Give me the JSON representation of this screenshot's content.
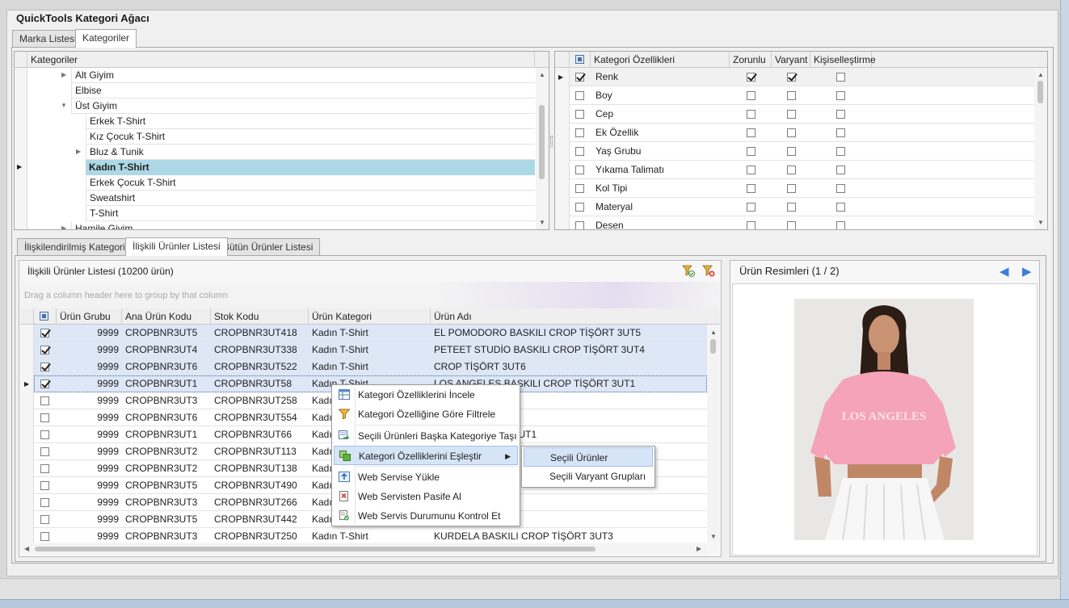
{
  "window": {
    "title": "QuickTools Kategori Ağacı"
  },
  "main_tabs": [
    {
      "label": "Marka Listesi"
    },
    {
      "label": "Kategoriler"
    }
  ],
  "category_tree": {
    "header": "Kategoriler",
    "nodes": [
      {
        "label": "Alt Giyim"
      },
      {
        "label": "Elbise"
      },
      {
        "label": "Üst Giyim"
      },
      {
        "label": "Erkek T-Shirt"
      },
      {
        "label": "Kız Çocuk T-Shirt"
      },
      {
        "label": "Bluz & Tunik"
      },
      {
        "label": "Kadın T-Shirt"
      },
      {
        "label": "Erkek Çocuk T-Shirt"
      },
      {
        "label": "Sweatshirt"
      },
      {
        "label": "T-Shirt"
      },
      {
        "label": "Hamile Giyim"
      }
    ]
  },
  "attributes": {
    "headers": {
      "name": "Kategori Özellikleri",
      "required": "Zorunlu",
      "variant": "Varyant",
      "custom": "Kişiselleştirme"
    },
    "rows": [
      {
        "name": "Renk",
        "selected": true,
        "required": true,
        "variant": true,
        "custom": false
      },
      {
        "name": "Boy",
        "selected": false,
        "required": false,
        "variant": false,
        "custom": false
      },
      {
        "name": "Cep",
        "selected": false,
        "required": false,
        "variant": false,
        "custom": false
      },
      {
        "name": "Ek Özellik",
        "selected": false,
        "required": false,
        "variant": false,
        "custom": false
      },
      {
        "name": "Yaş Grubu",
        "selected": false,
        "required": false,
        "variant": false,
        "custom": false
      },
      {
        "name": "Yıkama Talimatı",
        "selected": false,
        "required": false,
        "variant": false,
        "custom": false
      },
      {
        "name": "Kol Tipi",
        "selected": false,
        "required": false,
        "variant": false,
        "custom": false
      },
      {
        "name": "Materyal",
        "selected": false,
        "required": false,
        "variant": false,
        "custom": false
      },
      {
        "name": "Desen",
        "selected": false,
        "required": false,
        "variant": false,
        "custom": false
      }
    ]
  },
  "sub_tabs": [
    {
      "label": "İlişkilendirilmiş Kategoriler"
    },
    {
      "label": "İlişkili Ürünler Listesi"
    },
    {
      "label": "Bütün Ürünler Listesi"
    }
  ],
  "products": {
    "title": "İlişkili Ürünler Listesi (10200 ürün)",
    "group_hint": "Drag a column header here to group by that column",
    "columns": {
      "group": "Ürün Grubu",
      "main_code": "Ana Ürün Kodu",
      "stock": "Stok Kodu",
      "category": "Ürün Kategori",
      "name": "Ürün Adı"
    },
    "rows": [
      {
        "checked": true,
        "group": "9999",
        "main_code": "CROPBNR3UT5",
        "stock": "CROPBNR3UT418",
        "category": "Kadın T-Shirt",
        "name": "EL POMODORO BASKILI CROP TİŞÖRT 3UT5"
      },
      {
        "checked": true,
        "group": "9999",
        "main_code": "CROPBNR3UT4",
        "stock": "CROPBNR3UT338",
        "category": "Kadın T-Shirt",
        "name": "PETEET STUDİO BASKILI CROP TİŞÖRT 3UT4"
      },
      {
        "checked": true,
        "group": "9999",
        "main_code": "CROPBNR3UT6",
        "stock": "CROPBNR3UT522",
        "category": "Kadın T-Shirt",
        "name": "CROP TİŞÖRT 3UT6"
      },
      {
        "checked": true,
        "group": "9999",
        "main_code": "CROPBNR3UT1",
        "stock": "CROPBNR3UT58",
        "category": "Kadın T-Shirt",
        "name": "LOS ANGELES BASKILI CROP TİŞÖRT 3UT1"
      },
      {
        "checked": false,
        "group": "9999",
        "main_code": "CROPBNR3UT3",
        "stock": "CROPBNR3UT258",
        "category": "Kadın",
        "name": "ROP TİŞÖRT 3UT3"
      },
      {
        "checked": false,
        "group": "9999",
        "main_code": "CROPBNR3UT6",
        "stock": "CROPBNR3UT554",
        "category": "Kadın",
        "name": ""
      },
      {
        "checked": false,
        "group": "9999",
        "main_code": "CROPBNR3UT1",
        "stock": "CROPBNR3UT66",
        "category": "Kadın",
        "name": "LI CROP TİŞÖRT 3UT1"
      },
      {
        "checked": false,
        "group": "9999",
        "main_code": "CROPBNR3UT2",
        "stock": "CROPBNR3UT113",
        "category": "Kadın",
        "name": ""
      },
      {
        "checked": false,
        "group": "9999",
        "main_code": "CROPBNR3UT2",
        "stock": "CROPBNR3UT138",
        "category": "Kadın",
        "name": ""
      },
      {
        "checked": false,
        "group": "9999",
        "main_code": "CROPBNR3UT5",
        "stock": "CROPBNR3UT490",
        "category": "Kadın",
        "name": ""
      },
      {
        "checked": false,
        "group": "9999",
        "main_code": "CROPBNR3UT3",
        "stock": "CROPBNR3UT266",
        "category": "Kadın",
        "name": "ROP TİŞÖRT 3UT3"
      },
      {
        "checked": false,
        "group": "9999",
        "main_code": "CROPBNR3UT5",
        "stock": "CROPBNR3UT442",
        "category": "Kadın",
        "name": "ROP TİŞÖRT 3UT5"
      },
      {
        "checked": false,
        "group": "9999",
        "main_code": "CROPBNR3UT3",
        "stock": "CROPBNR3UT250",
        "category": "Kadın T-Shirt",
        "name": "KURDELA BASKILI CROP TİŞÖRT 3UT3"
      }
    ]
  },
  "context_menu": [
    {
      "label": "Kategori Özelliklerini İncele",
      "icon": "table-view-icon"
    },
    {
      "label": "Kategori Özelliğine Göre Filtrele",
      "icon": "funnel-icon"
    },
    {
      "label": "Seçili Ürünleri Başka Kategoriye Taşı",
      "icon": "move-icon"
    },
    {
      "label": "Kategori Özelliklerini Eşleştir",
      "icon": "match-icon"
    },
    {
      "label": "Web Servise Yükle",
      "icon": "upload-icon"
    },
    {
      "label": "Web Servisten Pasife Al",
      "icon": "deactivate-icon"
    },
    {
      "label": "Web Servis Durumunu Kontrol Et",
      "icon": "check-status-icon"
    }
  ],
  "submenu": [
    {
      "label": "Seçili Ürünler"
    },
    {
      "label": "Seçili Varyant Grupları"
    }
  ],
  "images_panel": {
    "title": "Ürün Resimleri (1 / 2)",
    "print_text": "LOS ANGELES"
  },
  "colors": {
    "selection": "#add8e6",
    "accent": "#3b7dd8",
    "shirt": "#f4a3b8"
  }
}
